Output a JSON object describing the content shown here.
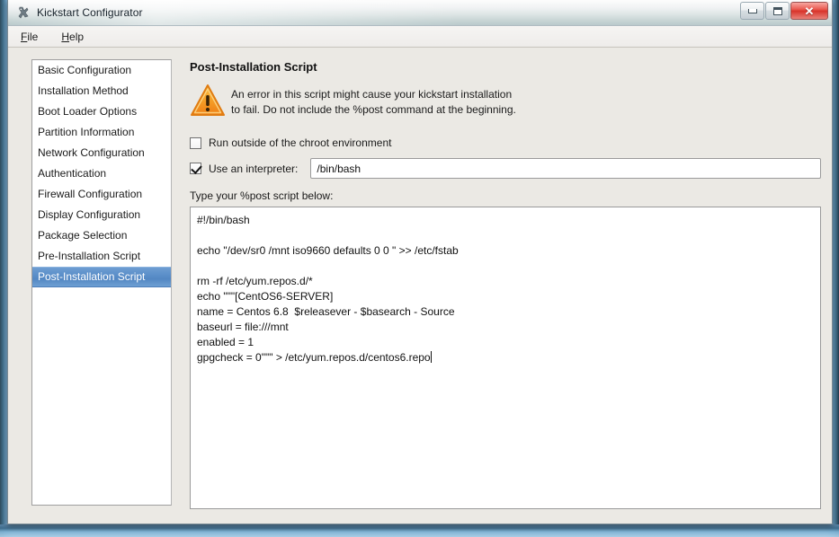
{
  "window": {
    "title": "Kickstart Configurator",
    "icon": "kickstart-app-icon",
    "buttons": {
      "minimize": "minimize-icon",
      "maximize": "maximize-icon",
      "close": "✕"
    }
  },
  "menubar": {
    "items": [
      {
        "label": "File",
        "mnemonic": "F"
      },
      {
        "label": "Help",
        "mnemonic": "H"
      }
    ]
  },
  "sidebar": {
    "items": [
      {
        "label": "Basic Configuration",
        "selected": false
      },
      {
        "label": "Installation Method",
        "selected": false
      },
      {
        "label": "Boot Loader Options",
        "selected": false
      },
      {
        "label": "Partition Information",
        "selected": false
      },
      {
        "label": "Network Configuration",
        "selected": false
      },
      {
        "label": "Authentication",
        "selected": false
      },
      {
        "label": "Firewall Configuration",
        "selected": false
      },
      {
        "label": "Display Configuration",
        "selected": false
      },
      {
        "label": "Package Selection",
        "selected": false
      },
      {
        "label": "Pre-Installation Script",
        "selected": false
      },
      {
        "label": "Post-Installation Script",
        "selected": true
      }
    ]
  },
  "main": {
    "panel_title": "Post-Installation Script",
    "warning": {
      "icon": "warning-triangle-icon",
      "line1": "An error in this script might cause your kickstart installation",
      "line2": "to fail. Do not include the %post command at the beginning."
    },
    "chroot_checkbox": {
      "label": "Run outside of the chroot environment",
      "checked": false
    },
    "interpreter_checkbox": {
      "label": "Use an interpreter:",
      "checked": true
    },
    "interpreter_input": {
      "value": "/bin/bash",
      "placeholder": ""
    },
    "script_label": "Type your %post script below:",
    "script_value": "#!/bin/bash\n\necho \"/dev/sr0 /mnt iso9660 defaults 0 0 \" >> /etc/fstab\n\nrm -rf /etc/yum.repos.d/*\necho \"\"\"[CentOS6-SERVER]\nname = Centos 6.8  $releasever - $basearch - Source\nbaseurl = file:///mnt\nenabled = 1\ngpgcheck = 0\"\"\" > /etc/yum.repos.d/centos6.repo"
  },
  "colors": {
    "selection_blue": "#5b8fc9",
    "warning_orange": "#f29222",
    "close_red": "#d8342b",
    "window_bg": "#ebe9e4"
  }
}
